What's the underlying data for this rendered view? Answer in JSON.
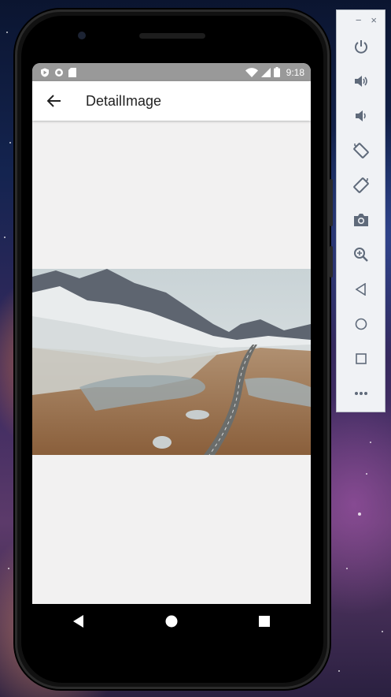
{
  "statusbar": {
    "time": "9:18",
    "left_icons": [
      "play-protect-icon",
      "circle-icon",
      "sd-card-icon"
    ],
    "right_icons": [
      "wifi-icon",
      "signal-icon",
      "battery-icon"
    ]
  },
  "appbar": {
    "title": "DetailImage",
    "back_icon": "arrow-left-icon"
  },
  "image": {
    "subject": "snowy-mountain-valley-road-photo"
  },
  "navbar": {
    "items": [
      "back-triangle-icon",
      "home-circle-icon",
      "recents-square-icon"
    ]
  },
  "emulator_toolbar": {
    "window_controls": [
      "−",
      "×"
    ],
    "items": [
      "power-icon",
      "volume-up-icon",
      "volume-down-icon",
      "rotate-left-icon",
      "rotate-right-icon",
      "camera-icon",
      "zoom-icon",
      "back-icon",
      "home-icon",
      "overview-icon",
      "more-icon"
    ]
  },
  "colors": {
    "statusbar": "#999999",
    "appbar": "#ffffff",
    "screen_bg": "#f2f1f1",
    "toolbar_icon": "#5f6a7a"
  }
}
